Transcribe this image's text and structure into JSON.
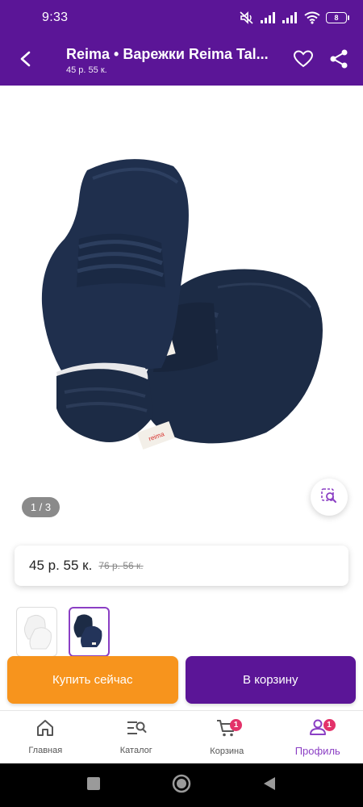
{
  "status_bar": {
    "time": "9:33",
    "battery": "8",
    "icons": [
      "mute-icon",
      "signal-icon",
      "signal-icon",
      "wifi-icon",
      "battery-icon"
    ]
  },
  "app_bar": {
    "title": "Reima • Варежки Reima Tal...",
    "subtitle": "45 р. 55 к.",
    "icons": [
      "back-arrow-icon",
      "heart-icon",
      "share-icon"
    ]
  },
  "gallery": {
    "counter": "1 / 3",
    "tag_text": "reima",
    "product_color": "#1c2b45"
  },
  "price": {
    "current": "45 р. 55 к.",
    "old": "76 р. 56 к."
  },
  "thumbnails": [
    {
      "color": "#f2f2f2",
      "selected": false
    },
    {
      "color": "#1c2b45",
      "selected": true
    }
  ],
  "actions": {
    "buy_now": "Купить сейчас",
    "add_to_cart": "В корзину"
  },
  "bottom_nav": {
    "items": [
      {
        "label": "Главная",
        "icon": "home-icon",
        "badge": ""
      },
      {
        "label": "Каталог",
        "icon": "catalog-search-icon",
        "badge": ""
      },
      {
        "label": "Корзина",
        "icon": "cart-icon",
        "badge": "1"
      },
      {
        "label": "Профиль",
        "icon": "profile-icon",
        "badge": "1"
      }
    ]
  },
  "colors": {
    "brand_purple": "#5b1597",
    "accent_orange": "#f7941d",
    "active_nav": "#8b3fc4",
    "badge_pink": "#e3326a"
  }
}
